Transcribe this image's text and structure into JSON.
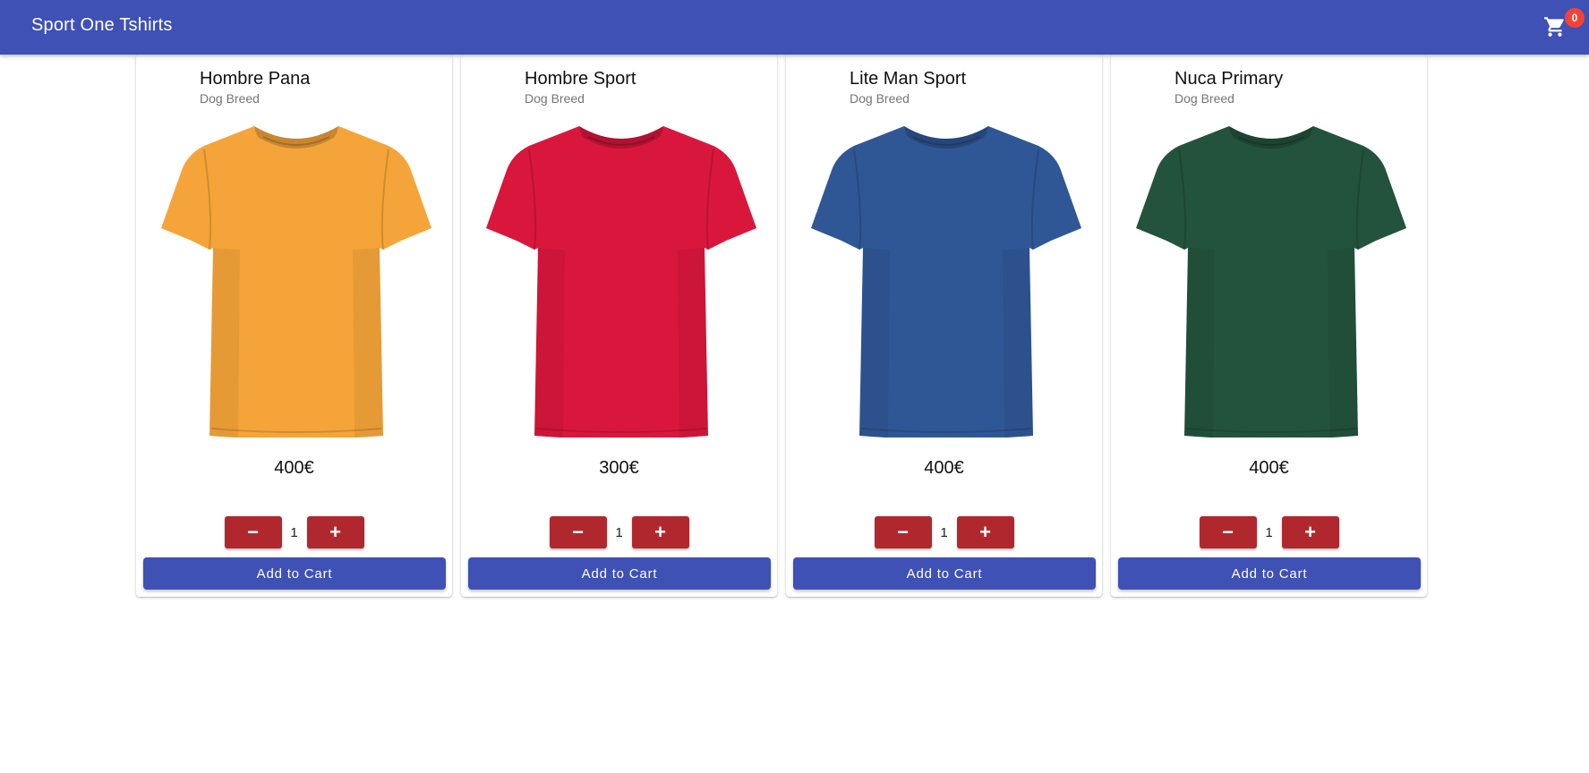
{
  "app": {
    "title": "Sport One Tshirts",
    "cart_count": "0",
    "primary_color": "#3f51b5",
    "accent_color": "#b0282e",
    "badge_color": "#f44336"
  },
  "products": [
    {
      "name": "Hombre Pana",
      "subtitle": "Dog Breed",
      "price": "400€",
      "quantity": "1",
      "decrement_label": "−",
      "increment_label": "+",
      "add_label": "Add to Cart",
      "color": "#f5a43a"
    },
    {
      "name": "Hombre Sport",
      "subtitle": "Dog Breed",
      "price": "300€",
      "quantity": "1",
      "decrement_label": "−",
      "increment_label": "+",
      "add_label": "Add to Cart",
      "color": "#d9173c"
    },
    {
      "name": "Lite Man Sport",
      "subtitle": "Dog Breed",
      "price": "400€",
      "quantity": "1",
      "decrement_label": "−",
      "increment_label": "+",
      "add_label": "Add to Cart",
      "color": "#2f5796"
    },
    {
      "name": "Nuca Primary",
      "subtitle": "Dog Breed",
      "price": "400€",
      "quantity": "1",
      "decrement_label": "−",
      "increment_label": "+",
      "add_label": "Add to Cart",
      "color": "#23533c"
    }
  ]
}
